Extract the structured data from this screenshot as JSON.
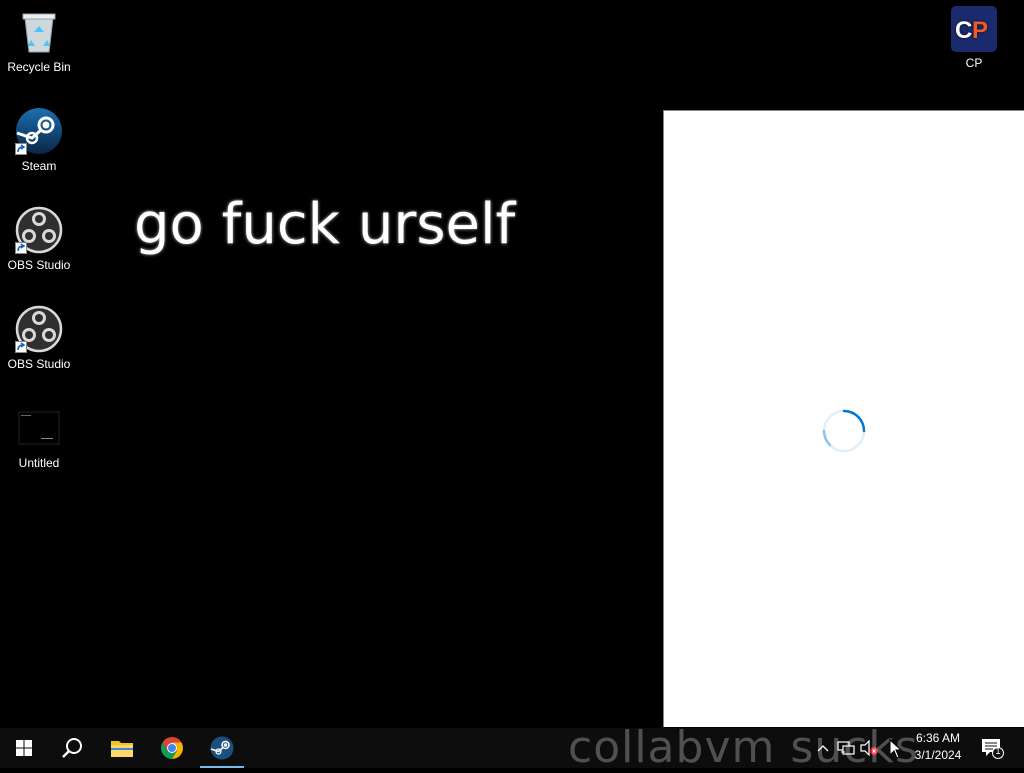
{
  "desktop": {
    "icons": [
      {
        "label": "Recycle Bin",
        "icon": "recycle-bin-icon"
      },
      {
        "label": "Steam",
        "icon": "steam-icon"
      },
      {
        "label": "OBS Studio",
        "icon": "obs-studio-icon"
      },
      {
        "label": "OBS Studio",
        "icon": "obs-studio-icon"
      },
      {
        "label": "Untitled",
        "icon": "image-file-icon"
      },
      {
        "label": "CP",
        "icon": "cp-app-icon"
      }
    ],
    "wallpaper_text": "go fuck urself",
    "watermark_text": "collabvm sucks"
  },
  "window": {
    "state": "loading",
    "spinner_color": "#0078d7"
  },
  "taskbar": {
    "buttons": [
      {
        "name": "start",
        "icon": "windows-logo-icon"
      },
      {
        "name": "search",
        "icon": "search-icon"
      },
      {
        "name": "file-explorer",
        "icon": "folder-icon"
      },
      {
        "name": "chrome",
        "icon": "chrome-icon"
      },
      {
        "name": "steam",
        "icon": "steam-icon",
        "active": true
      }
    ],
    "tray": {
      "time": "6:36 AM",
      "date": "3/1/2024",
      "notification_count": "1"
    }
  },
  "colors": {
    "desktop_bg": "#000000",
    "taskbar_bg": "#101010",
    "accent": "#76b9ed",
    "cp_icon_bg": "#1a2a6c",
    "cp_icon_p": "#f15a24"
  }
}
